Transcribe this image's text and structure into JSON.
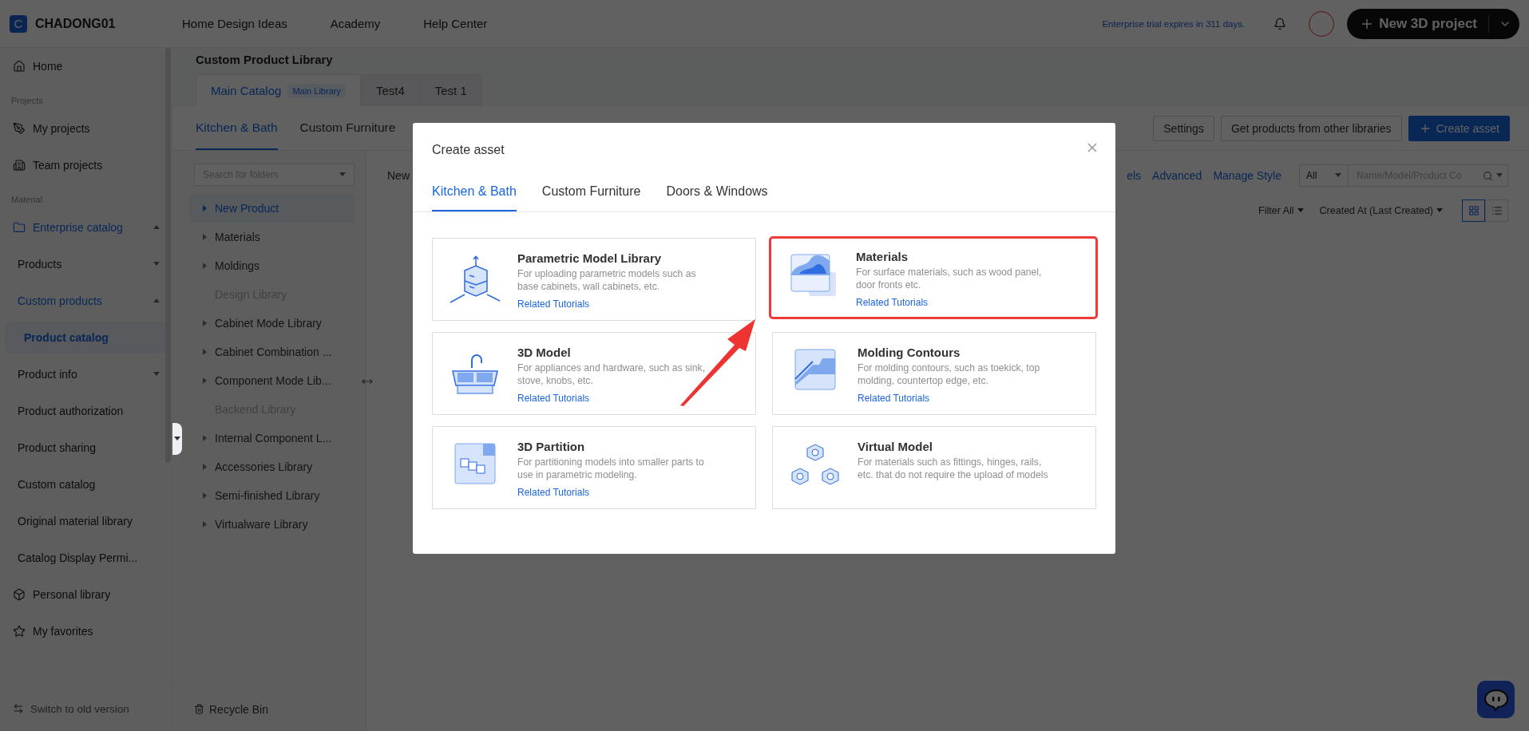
{
  "topbar": {
    "logo_letter": "C",
    "brand": "CHADONG01",
    "nav": [
      "Home Design Ideas",
      "Academy",
      "Help Center"
    ],
    "trial_notice": "Enterprise trial expires in 311 days.",
    "new_project": "New 3D project"
  },
  "sidebar": {
    "items": [
      {
        "kind": "top",
        "label": "Home",
        "selected": false
      },
      {
        "kind": "section",
        "label": "Projects"
      },
      {
        "kind": "top",
        "label": "My projects",
        "selected": false
      },
      {
        "kind": "top",
        "label": "Team projects",
        "selected": false
      },
      {
        "kind": "section",
        "label": "Material"
      },
      {
        "kind": "top",
        "label": "Enterprise catalog",
        "selected": false,
        "active": true,
        "expanded": true,
        "children": [
          {
            "label": "Products",
            "selected": false,
            "active": false,
            "expanded": false
          },
          {
            "label": "Custom products",
            "selected": false,
            "active": true,
            "expanded": true,
            "children": [
              {
                "label": "Product catalog",
                "selected": true,
                "active": true
              }
            ]
          },
          {
            "label": "Product info",
            "selected": false,
            "active": false,
            "expanded": false
          },
          {
            "label": "Product authorization",
            "selected": false,
            "active": false
          },
          {
            "label": "Product sharing",
            "selected": false,
            "active": false
          },
          {
            "label": "Custom catalog",
            "selected": false,
            "active": false
          },
          {
            "label": "Original material library",
            "selected": false,
            "active": false
          },
          {
            "label": "Catalog Display Permi...",
            "selected": false,
            "active": false
          }
        ]
      },
      {
        "kind": "top",
        "label": "Personal library",
        "selected": false
      },
      {
        "kind": "top",
        "label": "My favorites",
        "selected": false
      }
    ],
    "footer": "Switch to old version"
  },
  "main": {
    "title": "Custom Product Library",
    "catalog_tabs": [
      {
        "label": "Main Catalog",
        "badge": "Main Library",
        "selected": true
      },
      {
        "label": "Test4",
        "selected": false
      },
      {
        "label": "Test 1",
        "selected": false
      }
    ],
    "category_tabs": [
      {
        "label": "Kitchen & Bath",
        "selected": true
      },
      {
        "label": "Custom Furniture",
        "selected": false
      }
    ],
    "toolbar_buttons": [
      {
        "label": "Settings",
        "kind": "outline"
      },
      {
        "label": "Get products from other libraries",
        "kind": "outline"
      },
      {
        "label": "Create asset",
        "kind": "primary"
      }
    ],
    "folder_search": {
      "placeholder": "Search for folders"
    },
    "folders": [
      {
        "label": "New Product",
        "selected": true,
        "disabled": false
      },
      {
        "label": "Materials",
        "selected": false,
        "disabled": false
      },
      {
        "label": "Moldings",
        "selected": false,
        "disabled": false
      },
      {
        "label": "Design Library",
        "selected": false,
        "disabled": true
      },
      {
        "label": "Cabinet Mode Library",
        "selected": false,
        "disabled": false
      },
      {
        "label": "Cabinet Combination ...",
        "selected": false,
        "disabled": false
      },
      {
        "label": "Component Mode Lib...",
        "selected": false,
        "disabled": false
      },
      {
        "label": "Backend Library",
        "selected": false,
        "disabled": true
      },
      {
        "label": "Internal Component L...",
        "selected": false,
        "disabled": false
      },
      {
        "label": "Accessories Library",
        "selected": false,
        "disabled": false
      },
      {
        "label": "Semi-finished Library",
        "selected": false,
        "disabled": false
      },
      {
        "label": "Virtualware Library",
        "selected": false,
        "disabled": false
      }
    ],
    "recycle_bin": "Recycle Bin",
    "content": {
      "heading_partial": "New",
      "link_partial": "els",
      "links": [
        "Advanced",
        "Manage Style"
      ],
      "scope_select": "All",
      "search": {
        "placeholder": "Name/Model/Product Co"
      },
      "sort_filters": [
        "Filter All",
        "Created At (Last Created)"
      ],
      "view_toggle": [
        {
          "selected": true
        },
        {
          "selected": false
        }
      ]
    }
  },
  "modal": {
    "title": "Create asset",
    "tabs": [
      {
        "label": "Kitchen & Bath",
        "selected": true
      },
      {
        "label": "Custom Furniture",
        "selected": false
      },
      {
        "label": "Doors & Windows",
        "selected": false
      }
    ],
    "cards": [
      {
        "title": "Parametric Model Library",
        "description": "For uploading parametric models such as base cabinets, wall cabinets, etc.",
        "link": "Related Tutorials",
        "highlighted": false
      },
      {
        "title": "Materials",
        "description": "For surface materials, such as wood panel, door fronts etc.",
        "link": "Related Tutorials",
        "highlighted": true
      },
      {
        "title": "3D Model",
        "description": "For appliances and hardware, such as sink, stove, knobs, etc.",
        "link": "Related Tutorials",
        "highlighted": false
      },
      {
        "title": "Molding Contours",
        "description": "For molding contours, such as toekick, top molding, countertop edge, etc.",
        "link": "Related Tutorials",
        "highlighted": false
      },
      {
        "title": "3D Partition",
        "description": "For partitioning models into smaller parts to use in parametric modeling.",
        "link": "Related Tutorials",
        "highlighted": false
      },
      {
        "title": "Virtual Model",
        "description": "For materials such as fittings, hinges, rails, etc. that do not require the upload of models",
        "highlighted": false
      }
    ]
  }
}
